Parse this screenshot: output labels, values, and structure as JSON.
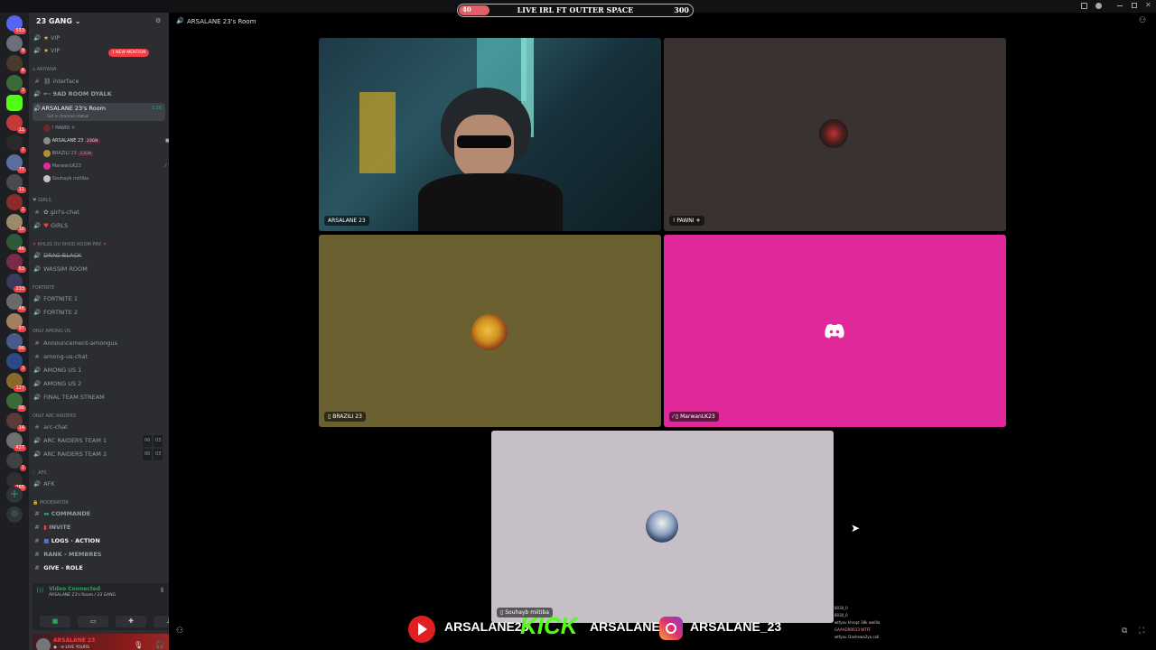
{
  "banner": {
    "left": "40",
    "title": "LIVE IRL FT OUTTER SPACE",
    "right": "300"
  },
  "room_title": "ARSALANE 23's Room",
  "server": {
    "name": "23 GANG",
    "caret": "⌄"
  },
  "mention": "1 NEW MENTION",
  "channels": {
    "vip1": "VIP",
    "vip2": "VIP",
    "cat_ariyana": "Ariyana",
    "interface": "interface",
    "9ad": "9AD ROOM DYALK",
    "room": "ARSALANE 23's Room",
    "room_sub": "Set a channel status",
    "room_time": "1:26",
    "u1": "! PAWNI ⚜",
    "u2": "ARSALANE 23",
    "u2badge": "23GN",
    "u3": "BRAZILI 23",
    "u3badge": "23GN",
    "u4": "MarwanLK23",
    "u5": "Souhayb miitiba",
    "cat_girls": "GIRLS",
    "girls_chat": "girl's-chat",
    "girls": "GIRLS",
    "cat_khl": "KHLß OU KHOD ROOM PRV",
    "drag": "DRAG BLACK",
    "wassim": "WASSIM ROOM",
    "cat_fortnite": "FORTNITE",
    "fn1": "FORTNITE 1",
    "fn2": "FORTNITE 2",
    "cat_among": "ONLY AMONG US",
    "ann": "Announcement-amongus",
    "auc": "among-us-chat",
    "au1": "AMONG US 1",
    "au2": "AMONG US 2",
    "fts": "FINAL TEAM STREAM",
    "cat_arc": "ONLY ARC RAIDERS",
    "arcchat": "arc-chat",
    "arc1": "ARC RAIDERS TEAM 1",
    "arc2": "ARC RAIDERS TEAM 2",
    "cnt1": "00",
    "cnt2": "03",
    "cat_afk": "AFK",
    "afk": "AFK",
    "cat_mod": "MODERATOR",
    "cmd": "COMMANDE",
    "invite": "INVITE",
    "logs": "LOGS · ACTION",
    "rank": "RANK - MEMBRES",
    "give": "GIVE - ROLE"
  },
  "voice": {
    "status": "Video Connected",
    "location": "ARSALANE 23's Room / 23 GANG"
  },
  "user": {
    "name": "ARSALANE 23",
    "status": "LIVE YOURS"
  },
  "tiles": {
    "t1": "ARSALANE 23",
    "t2": "! PAWNI ⚜",
    "t3": "BRAZILI 23",
    "t4": "MarwanLK23",
    "t5": "Souhayb miitiba"
  },
  "socials": {
    "youtube": "ARSALANE23",
    "kick_logo": "KICK",
    "kick": "ARSALANE1",
    "instagram": "ARSALANE_23"
  },
  "chat": [
    "8030_0",
    "8030_0",
    "wtfyou khropt 38k wallila",
    "GAAADRRR23 WTFF",
    "wtfyou l3ashewa2ya call"
  ],
  "server_badges": [
    "553",
    "9",
    "6",
    "3",
    "11",
    "7",
    "77",
    "11",
    "2",
    "10",
    "46",
    "53",
    "233",
    "46",
    "97",
    "98",
    "3",
    "127",
    "98",
    "14",
    "427",
    "1",
    "265"
  ],
  "colors": {
    "discord_blurple": "#5865f2",
    "tile_pink": "#e0289a",
    "tile_olive": "#6b6130",
    "tile_brown": "#3a3230",
    "tile_gray": "#c6c0c6",
    "kick_green": "#53fc18"
  }
}
